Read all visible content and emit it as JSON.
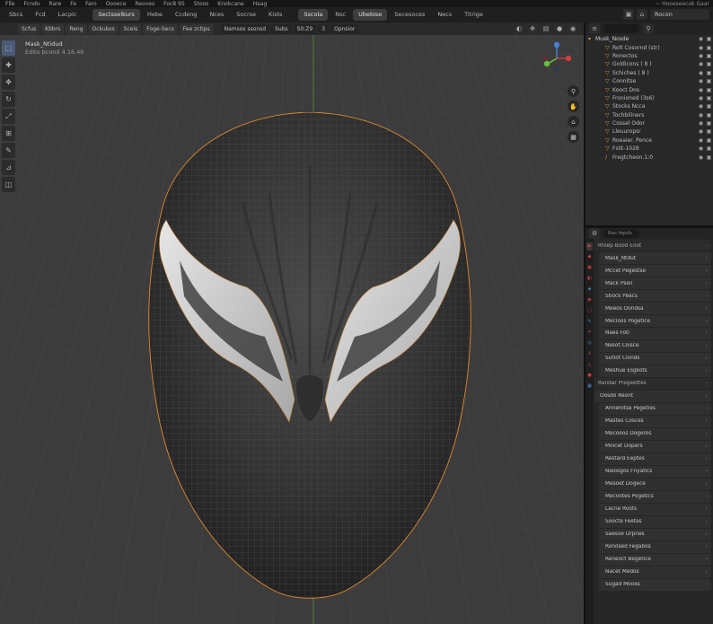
{
  "menu": [
    "Flle",
    "Fcndo",
    "Rare",
    "Fe",
    "Faro",
    "Oooece",
    "Reoves",
    "Foc8 9S",
    "Stoos",
    "Knokcane",
    "Haag"
  ],
  "menu_right": "~ Hooeseecok  Gaar",
  "tabs": [
    {
      "label": "Sbcs",
      "active": false
    },
    {
      "label": "Fcd",
      "active": false
    },
    {
      "label": "Lacpic",
      "active": false
    },
    {
      "label": "Sectsselkurs",
      "active": true
    },
    {
      "label": "Hebe",
      "active": false
    },
    {
      "label": "Ccdeng",
      "active": false
    },
    {
      "label": "Nces",
      "active": false
    },
    {
      "label": "Socrse",
      "active": false
    },
    {
      "label": "Kists",
      "active": false
    },
    {
      "label": "Sscola",
      "active": true
    },
    {
      "label": "Nsc",
      "active": false
    },
    {
      "label": "Ubebise",
      "active": true
    },
    {
      "label": "Secesoces",
      "active": false
    },
    {
      "label": "Necs",
      "active": false
    },
    {
      "label": "Titrige",
      "active": false
    }
  ],
  "scene_field": "Rocon",
  "viewport_header": {
    "items": [
      "Scfus",
      "Kbbrs",
      "Reng",
      "Ockukos",
      "Sceis",
      "Foge-Secs",
      "Fee zctips"
    ],
    "items2": [
      "Namsos ssonsd",
      "Subs",
      "S0:Z9",
      "3",
      "Opnsior"
    ]
  },
  "object_info": {
    "name": "Mask_Ntidud",
    "subtitle": "Edito bcond 4.16.40"
  },
  "outliner": {
    "search": "",
    "root": "Musk_Nosde",
    "items": [
      {
        "label": "Rolt Cosornd (str)",
        "icon": "mesh-icon"
      },
      {
        "label": "Ronectos",
        "icon": "mesh-icon"
      },
      {
        "label": "Goldicons ( 8 )",
        "icon": "mesh-icon"
      },
      {
        "label": "Schiches ( 8 )",
        "icon": "mesh-icon"
      },
      {
        "label": "Connitse",
        "icon": "mesh-icon"
      },
      {
        "label": "Kooct Dos",
        "icon": "mesh-icon"
      },
      {
        "label": "Fronioned (3s6)",
        "icon": "mesh-icon"
      },
      {
        "label": "Stocks Ncca",
        "icon": "mesh-icon"
      },
      {
        "label": "Tochblilners",
        "icon": "mesh-icon"
      },
      {
        "label": "Cossel Odor",
        "icon": "mesh-icon"
      },
      {
        "label": "Lleuuropsr",
        "icon": "mesh-icon"
      },
      {
        "label": "Roeaier. Pence",
        "icon": "mesh-icon"
      },
      {
        "label": "Fslit-1028",
        "icon": "mesh-icon"
      },
      {
        "label": "Fregtcheon.1:0",
        "icon": "curve-icon"
      }
    ]
  },
  "properties": {
    "search": "Ras fepds",
    "rows": [
      {
        "label": "Rfoep Bood Eoot",
        "sub": false,
        "head": true
      },
      {
        "label": "Mask_Ntdut",
        "sub": true
      },
      {
        "label": "Mccet Pegestse",
        "sub": true
      },
      {
        "label": "Mack Psell",
        "sub": true
      },
      {
        "label": "Sbock Peacs",
        "sub": true
      },
      {
        "label": "Meeos Oondsa",
        "sub": true
      },
      {
        "label": "Mecioos Pogetice",
        "sub": true
      },
      {
        "label": "Naes Foti",
        "sub": true
      },
      {
        "label": "Nesot Closce",
        "sub": true
      },
      {
        "label": "Sutiot Clonds",
        "sub": true
      },
      {
        "label": "Meshue Esgkots",
        "sub": true
      },
      {
        "label": "Randar Pregeettes",
        "sub": false,
        "head": true
      },
      {
        "label": "Oosdo Reont",
        "sub": false
      },
      {
        "label": "Ahnerotse Pegeties",
        "sub": true
      },
      {
        "label": "Mastes Cosces",
        "sub": true
      },
      {
        "label": "Mecooos Dogeros",
        "sub": true
      },
      {
        "label": "Moicet Dopers",
        "sub": true
      },
      {
        "label": "Restard Eeptes",
        "sub": true
      },
      {
        "label": "Nieosgos Fnyatics",
        "sub": true
      },
      {
        "label": "Mesoet Dogece",
        "sub": true
      },
      {
        "label": "Mecootes Pogetics",
        "sub": true
      },
      {
        "label": "Lacne Roots",
        "sub": true
      },
      {
        "label": "Soocte Feetes",
        "sub": true
      },
      {
        "label": "Saesoe Drpnes",
        "sub": true
      },
      {
        "label": "Ronosed Fegabos",
        "sub": true
      },
      {
        "label": "Reneoct Begetice",
        "sub": true
      },
      {
        "label": "Nacet Medos",
        "sub": true
      },
      {
        "label": "Sugad Mooes",
        "sub": true
      }
    ]
  },
  "accent": "#4a5a78",
  "selection_outline": "#e08a2c",
  "axis_colors": {
    "x": "#d23c3c",
    "y": "#6bbf3a",
    "z": "#4a7fd6"
  }
}
